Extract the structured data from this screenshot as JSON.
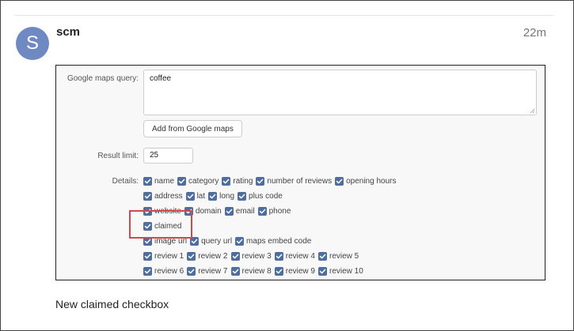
{
  "post": {
    "avatar_letter": "S",
    "username": "scm",
    "timestamp": "22m",
    "caption": "New claimed checkbox"
  },
  "form": {
    "query_label": "Google maps query:",
    "query_value": "coffee",
    "add_button": "Add from Google maps",
    "limit_label": "Result limit:",
    "limit_value": "25",
    "details_label": "Details:",
    "rows": [
      [
        {
          "label": "name"
        },
        {
          "label": "category"
        },
        {
          "label": "rating"
        },
        {
          "label": "number of reviews"
        },
        {
          "label": "opening hours"
        }
      ],
      [
        {
          "label": "address"
        },
        {
          "label": "lat"
        },
        {
          "label": "long"
        },
        {
          "label": "plus code"
        }
      ],
      [
        {
          "label": "website"
        },
        {
          "label": "domain"
        },
        {
          "label": "email"
        },
        {
          "label": "phone"
        }
      ],
      [
        {
          "label": "claimed"
        }
      ],
      [
        {
          "label": "image url"
        },
        {
          "label": "query url"
        },
        {
          "label": "maps embed code"
        }
      ],
      [
        {
          "label": "review 1"
        },
        {
          "label": "review 2"
        },
        {
          "label": "review 3"
        },
        {
          "label": "review 4"
        },
        {
          "label": "review 5"
        }
      ],
      [
        {
          "label": "review 6"
        },
        {
          "label": "review 7"
        },
        {
          "label": "review 8"
        },
        {
          "label": "review 9"
        },
        {
          "label": "review 10"
        }
      ]
    ]
  },
  "colors": {
    "checkbox": "#4d6e9e",
    "avatar": "#6f8ac2",
    "highlight": "#d04a4a"
  }
}
